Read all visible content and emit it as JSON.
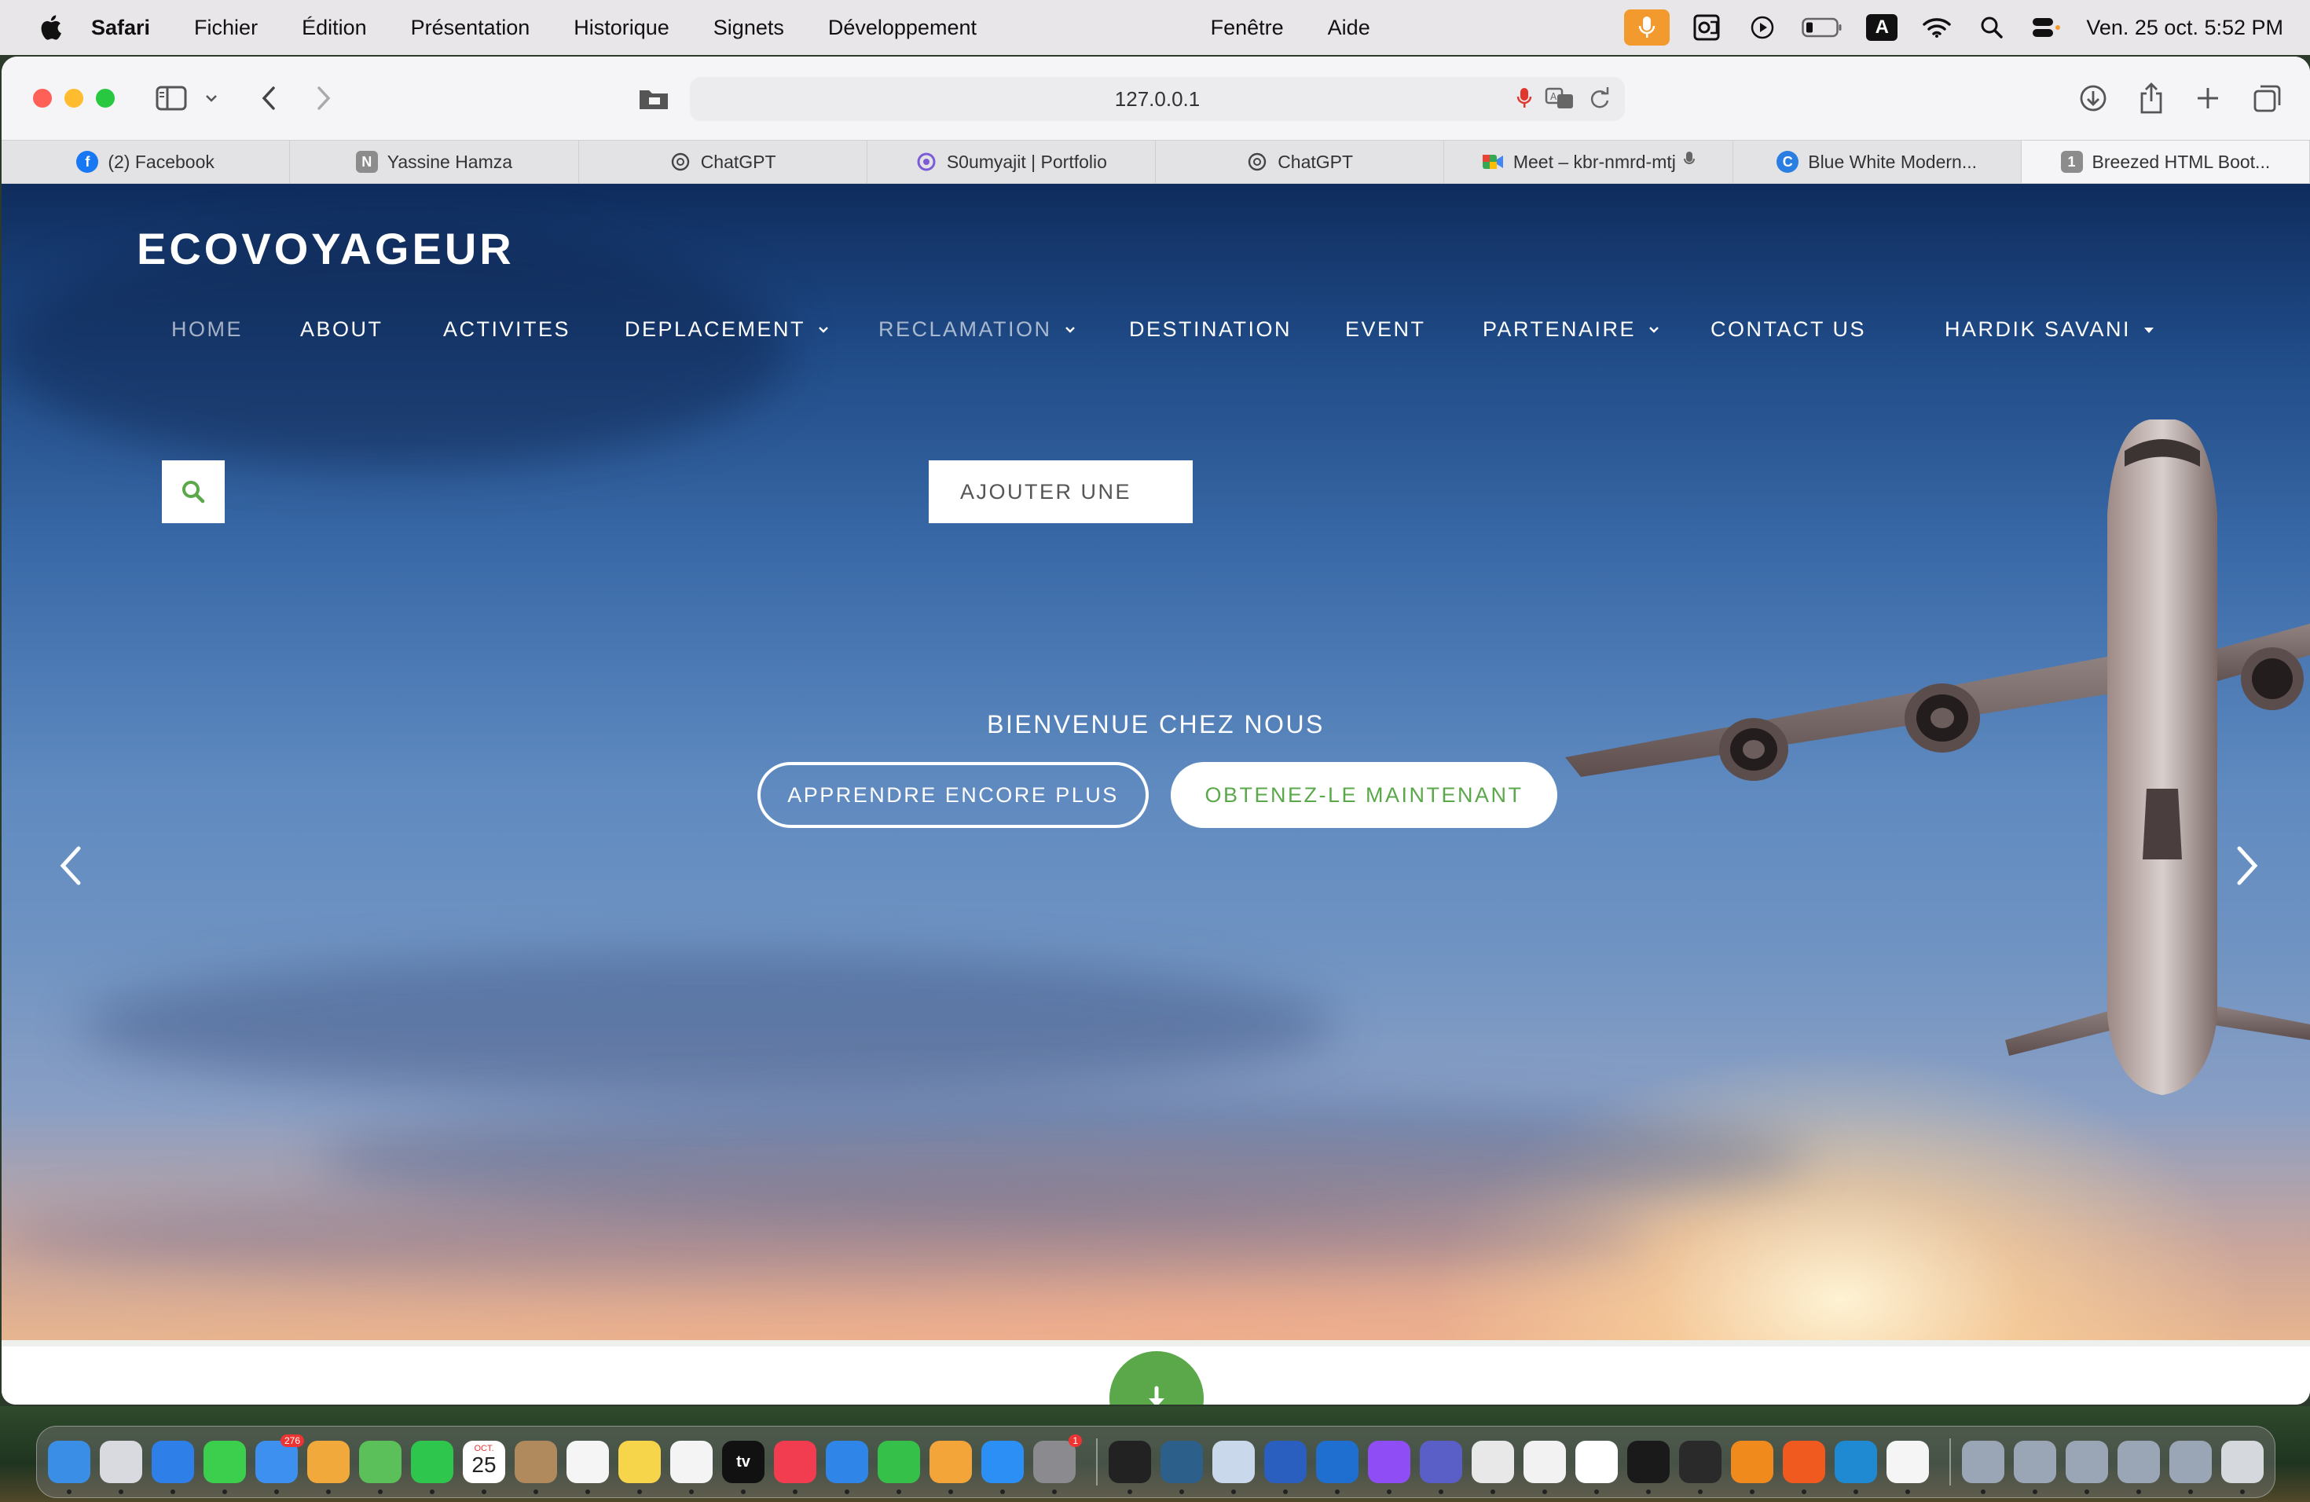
{
  "menubar": {
    "app_name": "Safari",
    "items": [
      "Fichier",
      "Édition",
      "Présentation",
      "Historique",
      "Signets",
      "Développement",
      "Fenêtre",
      "Aide"
    ],
    "clock": "Ven. 25 oct.  5:52 PM",
    "status_icons": [
      "microphone-icon",
      "outlook-icon",
      "play-icon",
      "battery-icon",
      "input-source-icon",
      "wifi-icon",
      "spotlight-icon",
      "control-center-icon"
    ],
    "input_source_label": "A"
  },
  "browser": {
    "url": "127.0.0.1",
    "tabs": [
      {
        "label": "(2) Facebook",
        "icon": "facebook-icon",
        "color": "#1877f2"
      },
      {
        "label": "Yassine Hamza",
        "icon": "notion-icon",
        "color": "#8c8c8c",
        "glyph": "N"
      },
      {
        "label": "ChatGPT",
        "icon": "chatgpt-icon",
        "color": "#444444"
      },
      {
        "label": "S0umyajit | Portfolio",
        "icon": "portfolio-icon",
        "color": "#7b5cd6"
      },
      {
        "label": "ChatGPT",
        "icon": "chatgpt-icon",
        "color": "#444444"
      },
      {
        "label": "Meet – kbr-nmrd-mtj",
        "icon": "google-meet-icon",
        "color": "#34a853"
      },
      {
        "label": "Blue White Modern...",
        "icon": "canva-icon",
        "color": "#2a7de1"
      },
      {
        "label": "Breezed HTML Boot...",
        "icon": "tab-icon",
        "color": "#8c8c8c",
        "glyph": "1"
      }
    ]
  },
  "site": {
    "brand": "ECOVOYAGEUR",
    "nav": [
      {
        "label": "HOME",
        "dim": true,
        "caret": false
      },
      {
        "label": "ABOUT",
        "dim": false,
        "caret": false
      },
      {
        "label": "ACTIVITES",
        "dim": false,
        "caret": false
      },
      {
        "label": "DEPLACEMENT",
        "dim": false,
        "caret": true
      },
      {
        "label": "RECLAMATION",
        "dim": true,
        "caret": true
      },
      {
        "label": "DESTINATION",
        "dim": false,
        "caret": false
      },
      {
        "label": "EVENT",
        "dim": false,
        "caret": false
      },
      {
        "label": "PARTENAIRE",
        "dim": false,
        "caret": true
      },
      {
        "label": "CONTACT US",
        "dim": false,
        "caret": false
      },
      {
        "label": "HARDIK SAVANI",
        "dim": false,
        "caret": true
      }
    ],
    "dropdown_item": "AJOUTER UNE",
    "welcome": "BIENVENUE CHEZ NOUS",
    "btn_learn": "APPRENDRE ENCORE PLUS",
    "btn_get": "OBTENEZ-LE MAINTENANT",
    "accent": "#5aa84a"
  },
  "dock": {
    "apps": [
      {
        "name": "finder-icon",
        "color": "#3a8ee6"
      },
      {
        "name": "launchpad-icon",
        "color": "#d9d9e0"
      },
      {
        "name": "safari-icon",
        "color": "#2f7fe8"
      },
      {
        "name": "messages-icon",
        "color": "#3ccf4e"
      },
      {
        "name": "mail-icon",
        "color": "#3d8ff0",
        "badge": "276"
      },
      {
        "name": "photos-icon",
        "color": "#f2a93b"
      },
      {
        "name": "maps-icon",
        "color": "#5bbf5a"
      },
      {
        "name": "facetime-icon",
        "color": "#2fc64d"
      },
      {
        "name": "calendar-icon",
        "color": "#ffffff",
        "month": "OCT.",
        "day": "25"
      },
      {
        "name": "contacts-icon",
        "color": "#b08a5c"
      },
      {
        "name": "reminders-icon",
        "color": "#f5f5f5"
      },
      {
        "name": "notes-icon",
        "color": "#f7d54a"
      },
      {
        "name": "freeform-icon",
        "color": "#f4f4f4"
      },
      {
        "name": "apple-tv-icon",
        "color": "#111111",
        "label": "tv"
      },
      {
        "name": "music-icon",
        "color": "#f23c50"
      },
      {
        "name": "keynote-icon",
        "color": "#2f86e8"
      },
      {
        "name": "numbers-icon",
        "color": "#35c04a"
      },
      {
        "name": "pages-icon",
        "color": "#f3a53a"
      },
      {
        "name": "app-store-icon",
        "color": "#2b8ff5"
      },
      {
        "name": "system-settings-icon",
        "color": "#8a8a8f",
        "badge": "1"
      },
      {
        "name": "terminal-icon",
        "color": "#222222"
      },
      {
        "name": "mysql-workbench-icon",
        "color": "#2c5f8a"
      },
      {
        "name": "preview-icon",
        "color": "#c9d8ea"
      },
      {
        "name": "word-icon",
        "color": "#2b5fbf"
      },
      {
        "name": "outlook-icon",
        "color": "#1f6fd0"
      },
      {
        "name": "messenger-icon",
        "color": "#8f4df5"
      },
      {
        "name": "teams-icon",
        "color": "#5a5fc7"
      },
      {
        "name": "tableplus-icon",
        "color": "#e8e8e8"
      },
      {
        "name": "mongodb-icon",
        "color": "#f2f2f2"
      },
      {
        "name": "slack-icon",
        "color": "#ffffff"
      },
      {
        "name": "activity-monitor-icon",
        "color": "#1a1a1a"
      },
      {
        "name": "console-icon",
        "color": "#2a2a2a"
      },
      {
        "name": "vlc-icon",
        "color": "#f08a1c"
      },
      {
        "name": "firefox-icon",
        "color": "#f05a1e"
      },
      {
        "name": "vscode-icon",
        "color": "#1f8ad2"
      },
      {
        "name": "document-icon",
        "color": "#f5f5f5"
      },
      {
        "name": "window-1-icon",
        "color": "#9aa6b5"
      },
      {
        "name": "window-2-icon",
        "color": "#9aa6b5"
      },
      {
        "name": "window-3-icon",
        "color": "#9aa6b5"
      },
      {
        "name": "window-4-icon",
        "color": "#9aa6b5"
      },
      {
        "name": "window-5-icon",
        "color": "#9aa6b5"
      },
      {
        "name": "trash-icon",
        "color": "#d5d8dc"
      }
    ]
  }
}
